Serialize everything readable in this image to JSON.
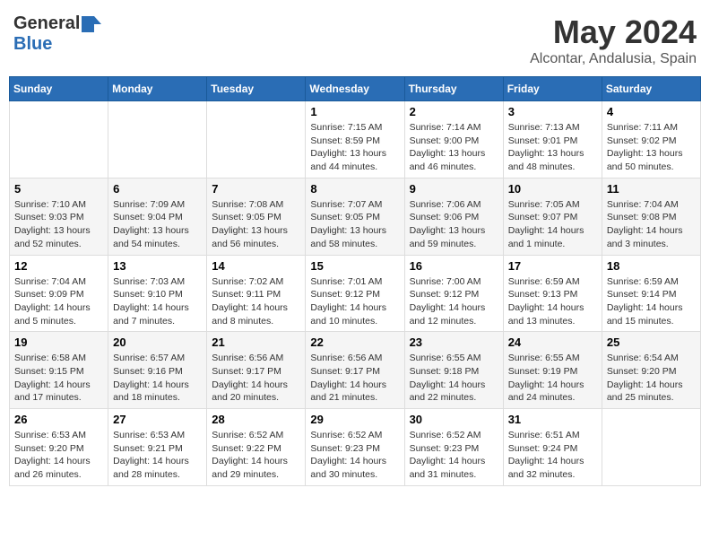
{
  "logo": {
    "general": "General",
    "blue": "Blue"
  },
  "title": {
    "month": "May 2024",
    "location": "Alcontar, Andalusia, Spain"
  },
  "headers": [
    "Sunday",
    "Monday",
    "Tuesday",
    "Wednesday",
    "Thursday",
    "Friday",
    "Saturday"
  ],
  "weeks": [
    [
      {
        "day": "",
        "content": ""
      },
      {
        "day": "",
        "content": ""
      },
      {
        "day": "",
        "content": ""
      },
      {
        "day": "1",
        "content": "Sunrise: 7:15 AM\nSunset: 8:59 PM\nDaylight: 13 hours and 44 minutes."
      },
      {
        "day": "2",
        "content": "Sunrise: 7:14 AM\nSunset: 9:00 PM\nDaylight: 13 hours and 46 minutes."
      },
      {
        "day": "3",
        "content": "Sunrise: 7:13 AM\nSunset: 9:01 PM\nDaylight: 13 hours and 48 minutes."
      },
      {
        "day": "4",
        "content": "Sunrise: 7:11 AM\nSunset: 9:02 PM\nDaylight: 13 hours and 50 minutes."
      }
    ],
    [
      {
        "day": "5",
        "content": "Sunrise: 7:10 AM\nSunset: 9:03 PM\nDaylight: 13 hours and 52 minutes."
      },
      {
        "day": "6",
        "content": "Sunrise: 7:09 AM\nSunset: 9:04 PM\nDaylight: 13 hours and 54 minutes."
      },
      {
        "day": "7",
        "content": "Sunrise: 7:08 AM\nSunset: 9:05 PM\nDaylight: 13 hours and 56 minutes."
      },
      {
        "day": "8",
        "content": "Sunrise: 7:07 AM\nSunset: 9:05 PM\nDaylight: 13 hours and 58 minutes."
      },
      {
        "day": "9",
        "content": "Sunrise: 7:06 AM\nSunset: 9:06 PM\nDaylight: 13 hours and 59 minutes."
      },
      {
        "day": "10",
        "content": "Sunrise: 7:05 AM\nSunset: 9:07 PM\nDaylight: 14 hours and 1 minute."
      },
      {
        "day": "11",
        "content": "Sunrise: 7:04 AM\nSunset: 9:08 PM\nDaylight: 14 hours and 3 minutes."
      }
    ],
    [
      {
        "day": "12",
        "content": "Sunrise: 7:04 AM\nSunset: 9:09 PM\nDaylight: 14 hours and 5 minutes."
      },
      {
        "day": "13",
        "content": "Sunrise: 7:03 AM\nSunset: 9:10 PM\nDaylight: 14 hours and 7 minutes."
      },
      {
        "day": "14",
        "content": "Sunrise: 7:02 AM\nSunset: 9:11 PM\nDaylight: 14 hours and 8 minutes."
      },
      {
        "day": "15",
        "content": "Sunrise: 7:01 AM\nSunset: 9:12 PM\nDaylight: 14 hours and 10 minutes."
      },
      {
        "day": "16",
        "content": "Sunrise: 7:00 AM\nSunset: 9:12 PM\nDaylight: 14 hours and 12 minutes."
      },
      {
        "day": "17",
        "content": "Sunrise: 6:59 AM\nSunset: 9:13 PM\nDaylight: 14 hours and 13 minutes."
      },
      {
        "day": "18",
        "content": "Sunrise: 6:59 AM\nSunset: 9:14 PM\nDaylight: 14 hours and 15 minutes."
      }
    ],
    [
      {
        "day": "19",
        "content": "Sunrise: 6:58 AM\nSunset: 9:15 PM\nDaylight: 14 hours and 17 minutes."
      },
      {
        "day": "20",
        "content": "Sunrise: 6:57 AM\nSunset: 9:16 PM\nDaylight: 14 hours and 18 minutes."
      },
      {
        "day": "21",
        "content": "Sunrise: 6:56 AM\nSunset: 9:17 PM\nDaylight: 14 hours and 20 minutes."
      },
      {
        "day": "22",
        "content": "Sunrise: 6:56 AM\nSunset: 9:17 PM\nDaylight: 14 hours and 21 minutes."
      },
      {
        "day": "23",
        "content": "Sunrise: 6:55 AM\nSunset: 9:18 PM\nDaylight: 14 hours and 22 minutes."
      },
      {
        "day": "24",
        "content": "Sunrise: 6:55 AM\nSunset: 9:19 PM\nDaylight: 14 hours and 24 minutes."
      },
      {
        "day": "25",
        "content": "Sunrise: 6:54 AM\nSunset: 9:20 PM\nDaylight: 14 hours and 25 minutes."
      }
    ],
    [
      {
        "day": "26",
        "content": "Sunrise: 6:53 AM\nSunset: 9:20 PM\nDaylight: 14 hours and 26 minutes."
      },
      {
        "day": "27",
        "content": "Sunrise: 6:53 AM\nSunset: 9:21 PM\nDaylight: 14 hours and 28 minutes."
      },
      {
        "day": "28",
        "content": "Sunrise: 6:52 AM\nSunset: 9:22 PM\nDaylight: 14 hours and 29 minutes."
      },
      {
        "day": "29",
        "content": "Sunrise: 6:52 AM\nSunset: 9:23 PM\nDaylight: 14 hours and 30 minutes."
      },
      {
        "day": "30",
        "content": "Sunrise: 6:52 AM\nSunset: 9:23 PM\nDaylight: 14 hours and 31 minutes."
      },
      {
        "day": "31",
        "content": "Sunrise: 6:51 AM\nSunset: 9:24 PM\nDaylight: 14 hours and 32 minutes."
      },
      {
        "day": "",
        "content": ""
      }
    ]
  ]
}
